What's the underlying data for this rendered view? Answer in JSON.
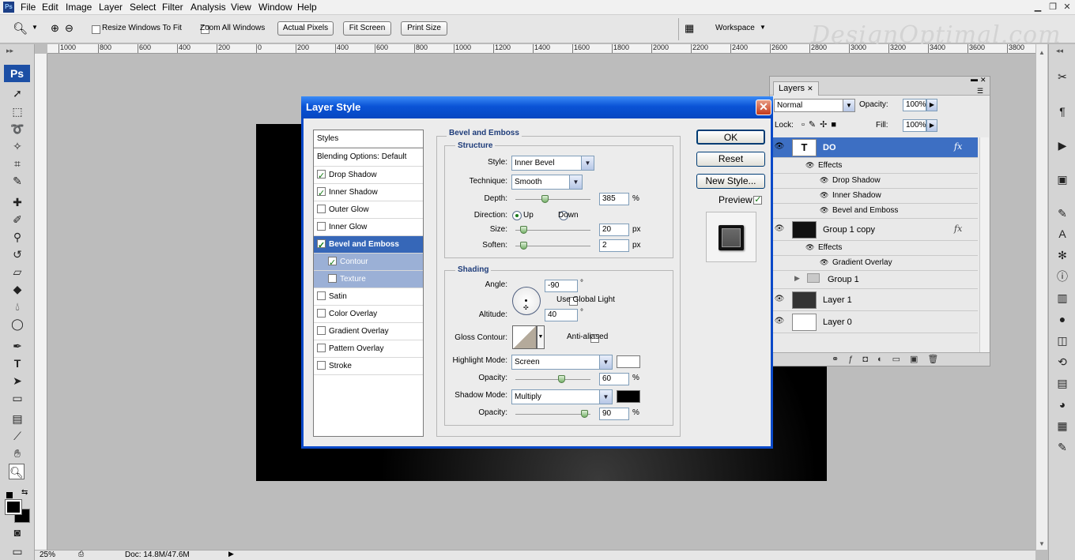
{
  "menubar": {
    "items": [
      "File",
      "Edit",
      "Image",
      "Layer",
      "Select",
      "Filter",
      "Analysis",
      "View",
      "Window",
      "Help"
    ],
    "app_icon": "Ps"
  },
  "options_bar": {
    "resize_windows_label": "Resize Windows To Fit",
    "zoom_all_label": "Zoom All Windows",
    "actual_pixels": "Actual Pixels",
    "fit_screen": "Fit Screen",
    "print_size": "Print Size",
    "workspace": "Workspace"
  },
  "watermark": "DesignOptimal.com",
  "ruler": {
    "h_ticks": [
      "1000",
      "800",
      "600",
      "400",
      "200",
      "0",
      "200",
      "400",
      "600",
      "800",
      "1000",
      "1200",
      "1400",
      "1600",
      "1800",
      "2000",
      "2200",
      "2400",
      "2600",
      "2800",
      "3000",
      "3200",
      "3400",
      "3600",
      "3800"
    ]
  },
  "status": {
    "zoom": "25%",
    "doc": "Doc: 14.8M/47.6M"
  },
  "left_panel": {
    "logo": "Ps"
  },
  "layers": {
    "tab": "Layers",
    "blend_mode": "Normal",
    "opacity_label": "Opacity:",
    "opacity_value": "100%",
    "lock_label": "Lock:",
    "fill_label": "Fill:",
    "fill_value": "100%",
    "rows": [
      {
        "name": "DO",
        "type": "text"
      },
      {
        "name": "Effects"
      },
      {
        "name": "Drop Shadow"
      },
      {
        "name": "Inner Shadow"
      },
      {
        "name": "Bevel and Emboss"
      },
      {
        "name": "Group 1 copy"
      },
      {
        "name": "Effects"
      },
      {
        "name": "Gradient Overlay"
      },
      {
        "name": "Group 1"
      },
      {
        "name": "Layer 1"
      },
      {
        "name": "Layer 0"
      }
    ],
    "thumb_text": "T",
    "fx": "fx"
  },
  "dialog": {
    "title": "Layer Style",
    "styles_header": "Styles",
    "blending": "Blending Options: Default",
    "list": [
      {
        "label": "Drop Shadow",
        "checked": true
      },
      {
        "label": "Inner Shadow",
        "checked": true
      },
      {
        "label": "Outer Glow",
        "checked": false
      },
      {
        "label": "Inner Glow",
        "checked": false
      },
      {
        "label": "Bevel and Emboss",
        "checked": true
      },
      {
        "label": "Contour",
        "checked": true
      },
      {
        "label": "Texture",
        "checked": false
      },
      {
        "label": "Satin",
        "checked": false
      },
      {
        "label": "Color Overlay",
        "checked": false
      },
      {
        "label": "Gradient Overlay",
        "checked": false
      },
      {
        "label": "Pattern Overlay",
        "checked": false
      },
      {
        "label": "Stroke",
        "checked": false
      }
    ],
    "section_title": "Bevel and Emboss",
    "structure": {
      "title": "Structure",
      "style_label": "Style:",
      "style_value": "Inner Bevel",
      "technique_label": "Technique:",
      "technique_value": "Smooth",
      "depth_label": "Depth:",
      "depth_value": "385",
      "depth_unit": "%",
      "direction_label": "Direction:",
      "up": "Up",
      "down": "Down",
      "size_label": "Size:",
      "size_value": "20",
      "size_unit": "px",
      "soften_label": "Soften:",
      "soften_value": "2",
      "soften_unit": "px"
    },
    "shading": {
      "title": "Shading",
      "angle_label": "Angle:",
      "angle_value": "-90",
      "angle_unit": "°",
      "global_light": "Use Global Light",
      "altitude_label": "Altitude:",
      "altitude_value": "40",
      "altitude_unit": "°",
      "gloss_label": "Gloss Contour:",
      "anti_aliased": "Anti-aliased",
      "highlight_label": "Highlight Mode:",
      "highlight_value": "Screen",
      "highlight_color": "#ffffff",
      "hl_opacity_label": "Opacity:",
      "hl_opacity_value": "60",
      "hl_opacity_unit": "%",
      "shadow_label": "Shadow Mode:",
      "shadow_value": "Multiply",
      "shadow_color": "#000000",
      "sh_opacity_label": "Opacity:",
      "sh_opacity_value": "90",
      "sh_opacity_unit": "%"
    },
    "buttons": {
      "ok": "OK",
      "reset": "Reset",
      "new_style": "New Style...",
      "preview": "Preview"
    }
  }
}
